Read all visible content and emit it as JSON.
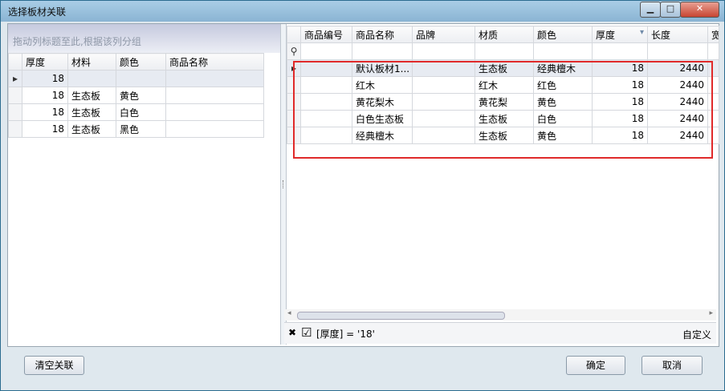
{
  "window": {
    "title": "选择板材关联",
    "min": "▁",
    "max": "□",
    "close": "✕"
  },
  "left": {
    "group_hint": "拖动列标题至此,根据该列分组",
    "columns": [
      "厚度",
      "材料",
      "颜色",
      "商品名称"
    ],
    "rows": [
      [
        "18",
        "",
        "",
        ""
      ],
      [
        "18",
        "生态板",
        "黄色",
        ""
      ],
      [
        "18",
        "生态板",
        "白色",
        ""
      ],
      [
        "18",
        "生态板",
        "黑色",
        ""
      ]
    ]
  },
  "right": {
    "columns": [
      "商品编号",
      "商品名称",
      "品牌",
      "材质",
      "颜色",
      "厚度",
      "长度",
      "宽"
    ],
    "rows": [
      [
        "",
        "默认板材1...",
        "",
        "生态板",
        "经典檀木",
        "18",
        "2440"
      ],
      [
        "",
        "红木",
        "",
        "红木",
        "红色",
        "18",
        "2440"
      ],
      [
        "",
        "黄花梨木",
        "",
        "黄花梨",
        "黄色",
        "18",
        "2440"
      ],
      [
        "",
        "白色生态板",
        "",
        "生态板",
        "白色",
        "18",
        "2440"
      ],
      [
        "",
        "经典檀木",
        "",
        "生态板",
        "黄色",
        "18",
        "2440"
      ]
    ],
    "filter_text": "[厚度] = '18'",
    "filter_custom": "自定义"
  },
  "buttons": {
    "clear": "清空关联",
    "ok": "确定",
    "cancel": "取消"
  },
  "icons": {
    "row_pointer": "▸",
    "filter_row_icon": "⚲",
    "close_filter": "✖",
    "checkbox": "☑",
    "scroll_left": "◂",
    "scroll_right": "▸",
    "filter_funnel": "▾"
  }
}
